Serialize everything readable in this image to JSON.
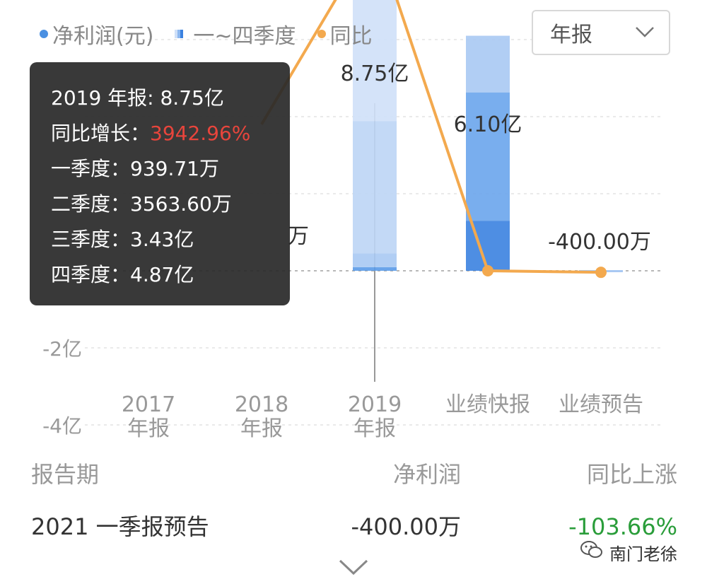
{
  "legend": {
    "profit": "净利润(元)",
    "quarters": "一~四季度",
    "yoy": "同比"
  },
  "period_select": {
    "value": "年报"
  },
  "chart_data": {
    "type": "bar",
    "categories": [
      "2017\n年报",
      "2018\n年报",
      "2019\n年报",
      "业绩快报",
      "业绩预告"
    ],
    "y_tick_labels": [
      "-2亿",
      "-4亿"
    ],
    "ylim": [
      -4.0,
      9.0
    ],
    "y_unit": "亿",
    "grid": true,
    "legend_position": "top-left",
    "series": [
      {
        "name": "净利润(元)",
        "values": [
          null,
          null,
          8.75,
          6.1,
          -0.04
        ]
      },
      {
        "name": "一~四季度",
        "stacked_values_by_category": [
          null,
          null,
          [
            0.0939,
            0.3564,
            3.43,
            4.87
          ],
          [
            1.3,
            3.33,
            1.47,
            0.0
          ],
          null
        ]
      },
      {
        "name": "同比",
        "values": [
          null,
          3.8,
          8.75,
          0.0,
          -0.04
        ]
      }
    ],
    "data_labels": [
      "万",
      "8.75亿",
      "6.10亿",
      "-400.00万"
    ]
  },
  "tooltip": {
    "title": "2019 年报: 8.75亿",
    "yoy_label": "同比增长：",
    "yoy_value": "3942.96%",
    "q1": "一季度：939.71万",
    "q2": "二季度：3563.60万",
    "q3": "三季度：3.43亿",
    "q4": "四季度：4.87亿"
  },
  "table": {
    "headers": [
      "报告期",
      "净利润",
      "同比上涨"
    ],
    "rows": [
      [
        "2021 一季报预告",
        "-400.00万",
        "-103.66%"
      ]
    ]
  },
  "watermark": {
    "text": "南门老徐"
  },
  "colors": {
    "line": "#f3a94e",
    "bar_light": "#cfe0f8",
    "bar_mid": "#a9c9f3",
    "bar_dark": "#5b9be8",
    "red": "#e8453c",
    "green": "#2a9d3a"
  }
}
